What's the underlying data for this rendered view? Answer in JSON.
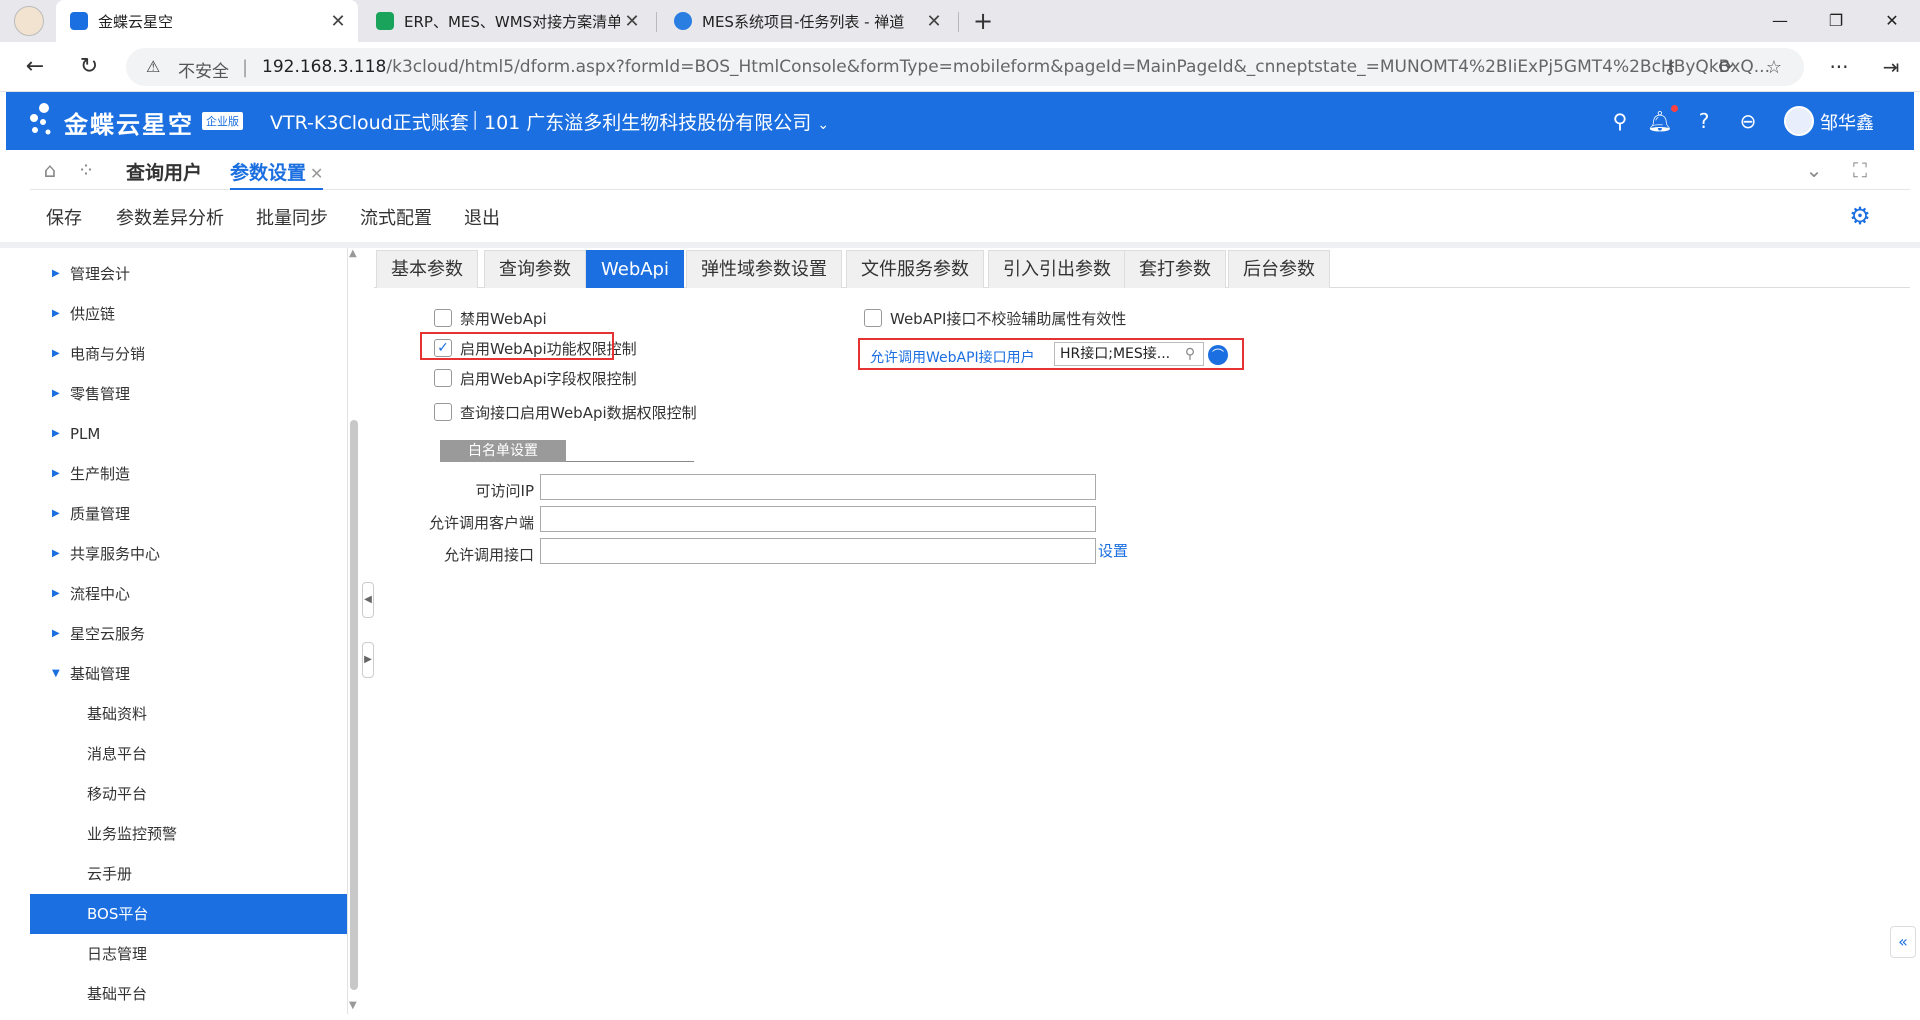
{
  "browser": {
    "tabs": [
      {
        "title": "金蝶云星空",
        "active": true,
        "favicon_color": "#1b6fe0"
      },
      {
        "title": "ERP、MES、WMS对接方案清单",
        "active": false,
        "favicon_color": "#19a35b"
      },
      {
        "title": "MES系统项目-任务列表 - 禅道",
        "active": false,
        "favicon_color": "#2a7de1"
      }
    ],
    "address": {
      "security_label": "不安全",
      "separator": "|",
      "host": "192.168.3.118",
      "path": "/k3cloud/html5/dform.aspx?formId=BOS_HtmlConsole&formType=mobileform&pageId=MainPageId&_cnneptstate_=MUNOMT4%2BIiExPj5GMT4%2BcHByQkBxQ..."
    }
  },
  "app": {
    "logo": "金蝶云星空",
    "edition": "企业版",
    "account": "VTR-K3Cloud正式账套",
    "separator": "|",
    "company": "101 广东溢多利生物科技股份有限公司",
    "user": "邹华鑫"
  },
  "page_tabs": [
    {
      "label": "查询用户",
      "active": false
    },
    {
      "label": "参数设置",
      "active": true
    }
  ],
  "toolbar": {
    "items": [
      "保存",
      "参数差异分析",
      "批量同步",
      "流式配置",
      "退出"
    ]
  },
  "tree": {
    "items": [
      {
        "label": "管理会计",
        "expanded": false,
        "level": 0
      },
      {
        "label": "供应链",
        "expanded": false,
        "level": 0
      },
      {
        "label": "电商与分销",
        "expanded": false,
        "level": 0
      },
      {
        "label": "零售管理",
        "expanded": false,
        "level": 0
      },
      {
        "label": "PLM",
        "expanded": false,
        "level": 0
      },
      {
        "label": "生产制造",
        "expanded": false,
        "level": 0
      },
      {
        "label": "质量管理",
        "expanded": false,
        "level": 0
      },
      {
        "label": "共享服务中心",
        "expanded": false,
        "level": 0
      },
      {
        "label": "流程中心",
        "expanded": false,
        "level": 0
      },
      {
        "label": "星空云服务",
        "expanded": false,
        "level": 0
      },
      {
        "label": "基础管理",
        "expanded": true,
        "level": 0
      },
      {
        "label": "基础资料",
        "level": 1
      },
      {
        "label": "消息平台",
        "level": 1
      },
      {
        "label": "移动平台",
        "level": 1
      },
      {
        "label": "业务监控预警",
        "level": 1
      },
      {
        "label": "云手册",
        "level": 1
      },
      {
        "label": "BOS平台",
        "level": 1,
        "selected": true
      },
      {
        "label": "日志管理",
        "level": 1
      },
      {
        "label": "基础平台",
        "level": 1
      }
    ]
  },
  "param_tabs": [
    "基本参数",
    "查询参数",
    "WebApi",
    "弹性域参数设置",
    "文件服务参数",
    "引入引出参数",
    "套打参数",
    "后台参数"
  ],
  "param_tabs_active": "WebApi",
  "webapi": {
    "left_checkboxes": [
      {
        "label": "禁用WebApi",
        "checked": false
      },
      {
        "label": "启用WebApi功能权限控制",
        "checked": true
      },
      {
        "label": "启用WebApi字段权限控制",
        "checked": false
      },
      {
        "label": "查询接口启用WebApi数据权限控制",
        "checked": false
      }
    ],
    "right_checkbox": {
      "label": "WebAPI接口不校验辅助属性有效性",
      "checked": false
    },
    "allowed_users_label": "允许调用WebAPI接口用户",
    "allowed_users_value": "HR接口;MES接..."
  },
  "whitelist": {
    "tab_label": "白名单设置",
    "fields": [
      {
        "label": "可访问IP",
        "value": ""
      },
      {
        "label": "允许调用客户端",
        "value": ""
      },
      {
        "label": "允许调用接口",
        "value": ""
      }
    ],
    "set_link": "设置"
  },
  "colors": {
    "brand": "#1b6fe0",
    "highlight_box": "#e53333"
  }
}
